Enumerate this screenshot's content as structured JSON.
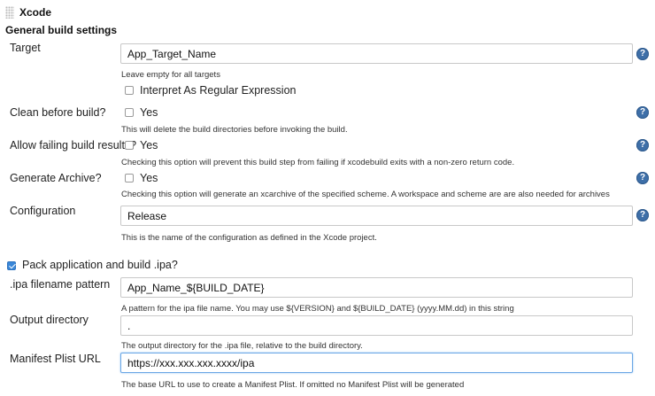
{
  "section": {
    "title": "Xcode",
    "subtitle": "General build settings"
  },
  "target": {
    "label": "Target",
    "value": "App_Target_Name",
    "help": "Leave empty for all targets",
    "regex_label": "Interpret As Regular Expression",
    "regex_checked": false
  },
  "clean": {
    "label": "Clean before build?",
    "checkbox_label": "Yes",
    "checked": false,
    "help": "This will delete the build directories before invoking the build."
  },
  "allow_failing": {
    "label": "Allow failing build results?",
    "checkbox_label": "Yes",
    "checked": false,
    "help": "Checking this option will prevent this build step from failing if xcodebuild exits with a non-zero return code."
  },
  "archive": {
    "label": "Generate Archive?",
    "checkbox_label": "Yes",
    "checked": false,
    "help": "Checking this option will generate an xcarchive of the specified scheme. A workspace and scheme are are also needed for archives"
  },
  "configuration": {
    "label": "Configuration",
    "value": "Release",
    "help": "This is the name of the configuration as defined in the Xcode project."
  },
  "pack": {
    "label": "Pack application and build .ipa?",
    "checked": true
  },
  "ipa_pattern": {
    "label": ".ipa filename pattern",
    "value": "App_Name_${BUILD_DATE}",
    "help": "A pattern for the ipa file name. You may use ${VERSION} and ${BUILD_DATE} (yyyy.MM.dd) in this string"
  },
  "output_dir": {
    "label": "Output directory",
    "value": ".",
    "help": "The output directory for the .ipa file, relative to the build directory."
  },
  "manifest": {
    "label": "Manifest Plist URL",
    "value": "https://xxx.xxx.xxx.xxxx/ipa",
    "help": "The base URL to use to create a Manifest Plist. If omitted no Manifest Plist will be generated"
  },
  "icons": {
    "help": "help-icon",
    "drag": "drag-handle-icon"
  },
  "colors": {
    "accent": "#3a87d8",
    "help_icon": "#3e6fa8",
    "focus_border": "#6aa7e6"
  }
}
